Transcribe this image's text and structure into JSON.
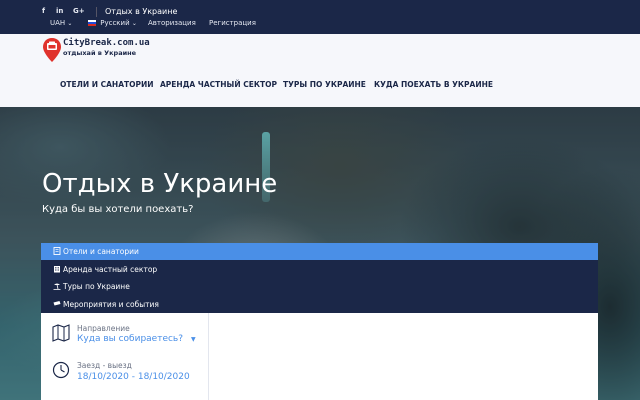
{
  "topbar": {
    "social": {
      "facebook": "f",
      "linkedin": "in",
      "google": "G+"
    },
    "title": "Отдых в Украине",
    "currency": "UAH",
    "language": "Русский",
    "login": "Авторизация",
    "register": "Регистрация",
    "chevron": "⌄"
  },
  "header": {
    "logo_name": "CityBreak.com.ua",
    "logo_tagline": "отдыхай в Украине",
    "nav": [
      "ОТЕЛИ И САНАТОРИИ",
      "АРЕНДА ЧАСТНЫЙ СЕКТОР",
      "ТУРЫ ПО УКРАИНЕ",
      "КУДА ПОЕХАТЬ В УКРАИНЕ"
    ]
  },
  "hero": {
    "title": "Отдых в Украине",
    "subtitle": "Куда бы вы хотели поехать?"
  },
  "tabs": [
    {
      "label": "Отели и санатории",
      "icon": "hotel-icon",
      "active": true
    },
    {
      "label": "Аренда частный сектор",
      "icon": "building-icon",
      "active": false
    },
    {
      "label": "Туры по Украине",
      "icon": "beach-icon",
      "active": false
    },
    {
      "label": "Мероприятия и события",
      "icon": "ticket-icon",
      "active": false
    }
  ],
  "search": {
    "direction_label": "Направление",
    "direction_value": "Куда вы собираетесь?",
    "direction_caret": "▼",
    "dates_label": "Заезд - выезд",
    "dates_value": "18/10/2020 - 18/10/2020"
  },
  "colors": {
    "navy": "#1b2748",
    "accent": "#4a8fe7",
    "logo_red": "#e0322c"
  }
}
